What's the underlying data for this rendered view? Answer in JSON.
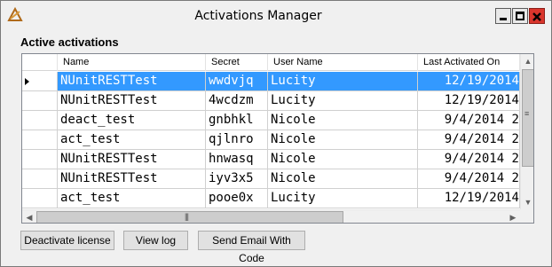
{
  "window": {
    "title": "Activations Manager"
  },
  "icons": {
    "app": "app-triangle-icon",
    "minimize": "minimize-icon",
    "maximize": "maximize-icon",
    "close": "close-icon",
    "row_selector": "row-pointer-icon"
  },
  "section": {
    "label": "Active activations"
  },
  "grid": {
    "columns": [
      "Name",
      "Secret",
      "User Name",
      "Last Activated On"
    ],
    "rows": [
      {
        "name": "NUnitRESTTest",
        "secret": "wwdvjq",
        "user": "Lucity",
        "date": "12/19/2014 ",
        "selected": true
      },
      {
        "name": "NUnitRESTTest",
        "secret": "4wcdzm",
        "user": "Lucity",
        "date": "12/19/2014 ",
        "selected": false
      },
      {
        "name": "deact_test",
        "secret": "gnbhkl",
        "user": "Nicole",
        "date": "9/4/2014 2",
        "selected": false
      },
      {
        "name": "act_test",
        "secret": "qjlnro",
        "user": "Nicole",
        "date": "9/4/2014 2",
        "selected": false
      },
      {
        "name": "NUnitRESTTest",
        "secret": "hnwasq",
        "user": "Nicole",
        "date": "9/4/2014 2",
        "selected": false
      },
      {
        "name": "NUnitRESTTest",
        "secret": "iyv3x5",
        "user": "Nicole",
        "date": "9/4/2014 2",
        "selected": false
      },
      {
        "name": "act_test",
        "secret": "pooe0x",
        "user": "Lucity",
        "date": "12/19/2014 ",
        "selected": false
      }
    ]
  },
  "buttons": {
    "deactivate": "Deactivate license",
    "view_log": "View log",
    "send_email": "Send Email With Code"
  },
  "colors": {
    "selection": "#3399ff",
    "close_button": "#d9352c"
  }
}
